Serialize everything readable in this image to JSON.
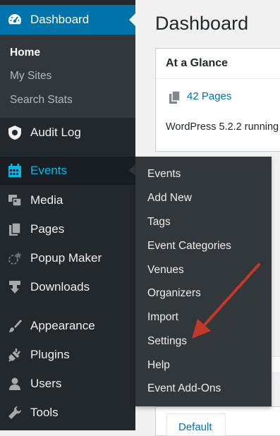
{
  "sidebar": {
    "dashboard": "Dashboard",
    "submenu": [
      "Home",
      "My Sites",
      "Search Stats"
    ],
    "items": [
      {
        "label": "Audit Log",
        "icon": "audit-log-icon"
      },
      {
        "label": "Events",
        "icon": "calendar-icon"
      },
      {
        "label": "Media",
        "icon": "media-icon"
      },
      {
        "label": "Pages",
        "icon": "pages-icon"
      },
      {
        "label": "Popup Maker",
        "icon": "popup-maker-icon"
      },
      {
        "label": "Downloads",
        "icon": "download-icon"
      },
      {
        "label": "Appearance",
        "icon": "paintbrush-icon"
      },
      {
        "label": "Plugins",
        "icon": "plugin-icon"
      },
      {
        "label": "Users",
        "icon": "user-icon"
      },
      {
        "label": "Tools",
        "icon": "wrench-icon"
      }
    ]
  },
  "flyout": [
    "Events",
    "Add New",
    "Tags",
    "Event Categories",
    "Venues",
    "Organizers",
    "Import",
    "Settings",
    "Help",
    "Event Add-Ons"
  ],
  "main": {
    "title": "Dashboard",
    "glance_title": "At a Glance",
    "pages_link": "42 Pages",
    "version_text": "WordPress 5.2.2 running",
    "default_label": "Default"
  },
  "colors": {
    "sidebar_bg": "#23282d",
    "accent": "#0073aa",
    "active_text": "#00b9eb",
    "annotation_arrow": "#c0392b"
  }
}
